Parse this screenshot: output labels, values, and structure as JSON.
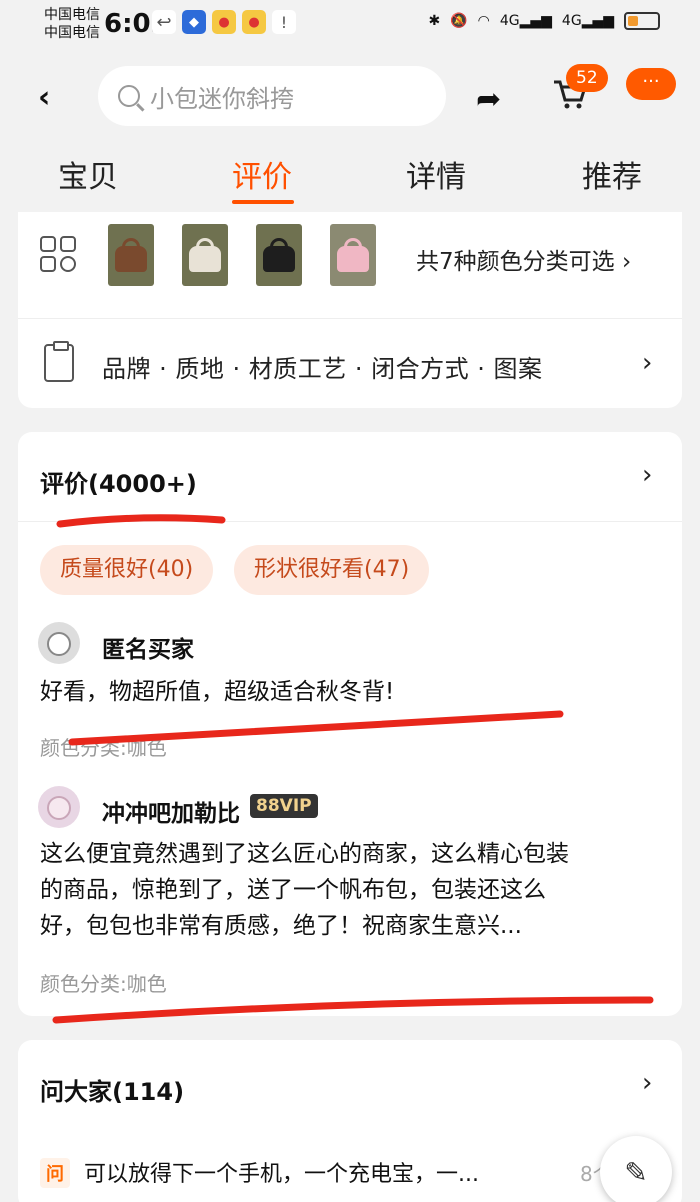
{
  "status_bar": {
    "carrier_1": "中国电信",
    "carrier_2": "中国电信",
    "time": "6:03",
    "network_1": "4G",
    "network_2": "4G"
  },
  "header": {
    "search_placeholder": "小包迷你斜挎",
    "cart_count": "52",
    "more_label": "···",
    "tabs": [
      "宝贝",
      "评价",
      "详情",
      "推荐"
    ],
    "active_tab": "评价"
  },
  "variants": {
    "thumbnail_colors": [
      "#7a4a2e",
      "#e8e2d6",
      "#1e1e1e",
      "#f0b7c4"
    ],
    "summary": "共7种颜色分类可选"
  },
  "attributes": {
    "label": "品牌 · 质地 · 材质工艺 · 闭合方式 · 图案"
  },
  "reviews": {
    "title": "评价(4000+)",
    "tags": [
      "质量很好(40)",
      "形状很好看(47)"
    ],
    "items": [
      {
        "user": "匿名买家",
        "text": "好看，物超所值，超级适合秋冬背!",
        "meta": "颜色分类:咖色"
      },
      {
        "user": "冲冲吧加勒比",
        "vip": "88VIP",
        "text_lines": [
          "这么便宜竟然遇到了这么匠心的商家，这么精心包装",
          "的商品，惊艳到了，送了一个帆布包，包装还这么",
          "好，包包也非常有质感，绝了！祝商家生意兴..."
        ],
        "meta": "颜色分类:咖色"
      }
    ]
  },
  "questions": {
    "title": "问大家(114)",
    "badge": "问",
    "first_question": "可以放得下一个手机，一个充电宝，一...",
    "count": "8个"
  },
  "accent_color": "#ff5000",
  "annotation_color": "#e8271b"
}
